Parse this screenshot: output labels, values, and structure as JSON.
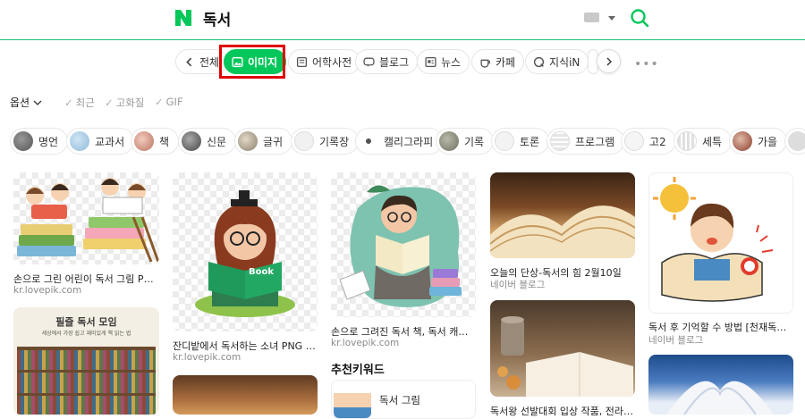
{
  "header": {
    "query": "독서"
  },
  "colors": {
    "brand": "#03c75a",
    "highlight": "#e00000"
  },
  "tabs": [
    {
      "label": "전체",
      "icon": "chevron-left-icon"
    },
    {
      "label": "이미지",
      "icon": "image-icon",
      "active": true
    },
    {
      "label": "어학사전",
      "icon": "dictionary-icon"
    },
    {
      "label": "블로그",
      "icon": "blog-icon"
    },
    {
      "label": "뉴스",
      "icon": "news-icon"
    },
    {
      "label": "카페",
      "icon": "cafe-icon"
    },
    {
      "label": "지식iN",
      "icon": "q-icon"
    }
  ],
  "options": {
    "label": "옵션",
    "checks": [
      "최근",
      "고화질",
      "GIF"
    ]
  },
  "chips": [
    "명언",
    "교과서",
    "책",
    "신문",
    "글귀",
    "기록장",
    "캘리그라피",
    "기록",
    "토론",
    "프로그램",
    "고2",
    "세특",
    "가을"
  ],
  "results": [
    {
      "caption": "손으로 그린 어린이 독서 그림 PNG 일...",
      "source": "kr.lovepik.com"
    },
    {
      "caption": "잔디밭에서 독서하는 소녀 PNG 일러스...",
      "source": "kr.lovepik.com"
    },
    {
      "caption": "손으로 그려진 독서 책, 독서 캐릭터, 비...",
      "source": "kr.lovepik.com"
    },
    {
      "caption": "오늘의 단상-독서의 힘 2월10일",
      "source": "네이버 블로그"
    },
    {
      "caption": "독서 후 기억할 수 방법 [천재독서법]",
      "source": "네이버 블로그"
    },
    {
      "caption": "독서왕 선발대회 입상 작품, 전라남도 독...",
      "source": ""
    },
    {
      "caption": "",
      "source": ""
    },
    {
      "caption": "",
      "source": ""
    },
    {
      "caption": "",
      "source": ""
    }
  ],
  "book_poster_title": "필즐 독서 모임",
  "book_poster_sub": "세상에서 가장 쉽고 재미있게 책 읽는 법",
  "book_label": "Book",
  "recommended": {
    "title": "추천키워드",
    "items": [
      "독서 그림"
    ]
  }
}
